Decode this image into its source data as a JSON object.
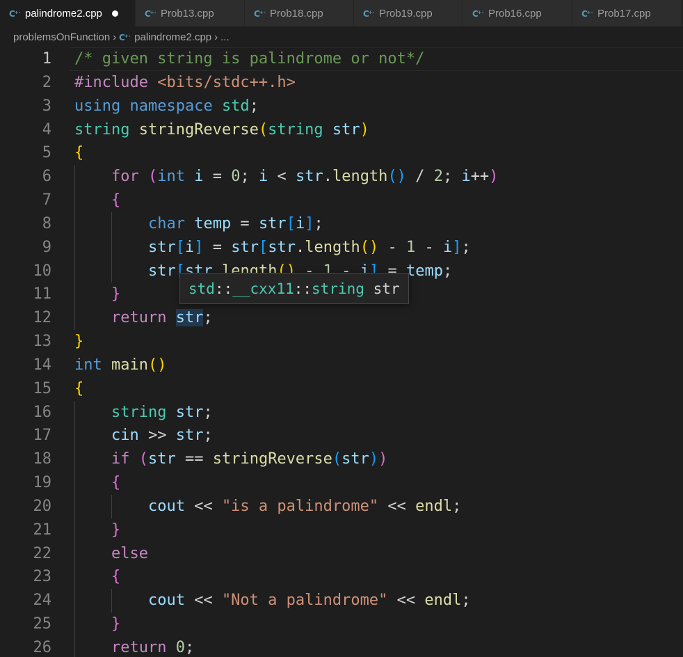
{
  "tabs": [
    {
      "label": "palindrome2.cpp",
      "active": true,
      "dirty": true
    },
    {
      "label": "Prob13.cpp",
      "active": false
    },
    {
      "label": "Prob18.cpp",
      "active": false
    },
    {
      "label": "Prob19.cpp",
      "active": false
    },
    {
      "label": "Prob16.cpp",
      "active": false
    },
    {
      "label": "Prob17.cpp",
      "active": false
    }
  ],
  "breadcrumb": {
    "folder": "problemsOnFunction",
    "file": "palindrome2.cpp",
    "more": "..."
  },
  "hover": {
    "parts": [
      "std",
      "::",
      "__cxx11",
      "::",
      "string",
      " ",
      "str"
    ]
  },
  "colors": {
    "comment": "#6a9955",
    "keyword": "#569cd6",
    "control": "#c586c0",
    "type": "#4ec9b0",
    "function": "#dcdcaa",
    "variable": "#9cdcfe",
    "number": "#b5cea8",
    "string": "#ce9178",
    "bracket1": "#ffd700",
    "bracket2": "#da70d6",
    "bracket3": "#179fff",
    "cpp_icon": "#519aba"
  },
  "editor": {
    "current_line": 1,
    "lines": [
      {
        "n": "1",
        "indent": 0,
        "tokens": [
          [
            "/* given string is palindrome or not*/",
            "comment"
          ]
        ]
      },
      {
        "n": "2",
        "indent": 0,
        "tokens": [
          [
            "#include ",
            "pre"
          ],
          [
            "<bits/stdc++.h>",
            "inc"
          ]
        ]
      },
      {
        "n": "3",
        "indent": 0,
        "tokens": [
          [
            "using ",
            "kw"
          ],
          [
            "namespace ",
            "kw"
          ],
          [
            "std",
            "type"
          ],
          [
            ";",
            "op"
          ]
        ]
      },
      {
        "n": "4",
        "indent": 0,
        "tokens": [
          [
            "string ",
            "type"
          ],
          [
            "stringReverse",
            "fn"
          ],
          [
            "(",
            "b1"
          ],
          [
            "string ",
            "type"
          ],
          [
            "str",
            "var"
          ],
          [
            ")",
            "b1"
          ]
        ]
      },
      {
        "n": "5",
        "indent": 0,
        "tokens": [
          [
            "{",
            "b1"
          ]
        ]
      },
      {
        "n": "6",
        "indent": 1,
        "tokens": [
          [
            "    ",
            "op"
          ],
          [
            "for ",
            "ctrl"
          ],
          [
            "(",
            "b2"
          ],
          [
            "int ",
            "kw"
          ],
          [
            "i",
            "var"
          ],
          [
            " = ",
            "op"
          ],
          [
            "0",
            "num"
          ],
          [
            "; ",
            "op"
          ],
          [
            "i",
            "var"
          ],
          [
            " < ",
            "op"
          ],
          [
            "str",
            "var"
          ],
          [
            ".",
            "op"
          ],
          [
            "length",
            "fn"
          ],
          [
            "()",
            "b3"
          ],
          [
            " / ",
            "op"
          ],
          [
            "2",
            "num"
          ],
          [
            "; ",
            "op"
          ],
          [
            "i",
            "var"
          ],
          [
            "++",
            "op"
          ],
          [
            ")",
            "b2"
          ]
        ]
      },
      {
        "n": "7",
        "indent": 1,
        "tokens": [
          [
            "    ",
            "op"
          ],
          [
            "{",
            "b2"
          ]
        ]
      },
      {
        "n": "8",
        "indent": 2,
        "tokens": [
          [
            "        ",
            "op"
          ],
          [
            "char ",
            "kw"
          ],
          [
            "temp",
            "var"
          ],
          [
            " = ",
            "op"
          ],
          [
            "str",
            "var"
          ],
          [
            "[",
            "b3"
          ],
          [
            "i",
            "var"
          ],
          [
            "]",
            "b3"
          ],
          [
            ";",
            "op"
          ]
        ]
      },
      {
        "n": "9",
        "indent": 2,
        "tokens": [
          [
            "        ",
            "op"
          ],
          [
            "str",
            "var"
          ],
          [
            "[",
            "b3"
          ],
          [
            "i",
            "var"
          ],
          [
            "]",
            "b3"
          ],
          [
            " = ",
            "op"
          ],
          [
            "str",
            "var"
          ],
          [
            "[",
            "b3"
          ],
          [
            "str",
            "var"
          ],
          [
            ".",
            "op"
          ],
          [
            "length",
            "fn"
          ],
          [
            "()",
            "b1"
          ],
          [
            " - ",
            "op"
          ],
          [
            "1",
            "num"
          ],
          [
            " - ",
            "op"
          ],
          [
            "i",
            "var"
          ],
          [
            "]",
            "b3"
          ],
          [
            ";",
            "op"
          ]
        ]
      },
      {
        "n": "10",
        "indent": 2,
        "tokens": [
          [
            "        ",
            "op"
          ],
          [
            "str",
            "var"
          ],
          [
            "[",
            "b3"
          ],
          [
            "str",
            "var"
          ],
          [
            ".",
            "op"
          ],
          [
            "length",
            "fn"
          ],
          [
            "()",
            "b1"
          ],
          [
            " - ",
            "op"
          ],
          [
            "1",
            "num"
          ],
          [
            " - ",
            "op"
          ],
          [
            "i",
            "var"
          ],
          [
            "]",
            "b3"
          ],
          [
            " = ",
            "op"
          ],
          [
            "temp",
            "var"
          ],
          [
            ";",
            "op"
          ]
        ]
      },
      {
        "n": "11",
        "indent": 1,
        "tokens": [
          [
            "    ",
            "op"
          ],
          [
            "}",
            "b2"
          ]
        ]
      },
      {
        "n": "12",
        "indent": 1,
        "tokens": [
          [
            "    ",
            "op"
          ],
          [
            "return ",
            "ctrl"
          ],
          [
            "str",
            "var hl"
          ],
          [
            ";",
            "op"
          ]
        ]
      },
      {
        "n": "13",
        "indent": 0,
        "tokens": [
          [
            "}",
            "b1"
          ]
        ]
      },
      {
        "n": "14",
        "indent": 0,
        "tokens": [
          [
            "int ",
            "kw"
          ],
          [
            "main",
            "fn"
          ],
          [
            "()",
            "b1"
          ]
        ]
      },
      {
        "n": "15",
        "indent": 0,
        "tokens": [
          [
            "{",
            "b1"
          ]
        ]
      },
      {
        "n": "16",
        "indent": 1,
        "tokens": [
          [
            "    ",
            "op"
          ],
          [
            "string ",
            "type"
          ],
          [
            "str",
            "var"
          ],
          [
            ";",
            "op"
          ]
        ]
      },
      {
        "n": "17",
        "indent": 1,
        "tokens": [
          [
            "    ",
            "op"
          ],
          [
            "cin",
            "var"
          ],
          [
            " >> ",
            "op"
          ],
          [
            "str",
            "var"
          ],
          [
            ";",
            "op"
          ]
        ]
      },
      {
        "n": "18",
        "indent": 1,
        "tokens": [
          [
            "    ",
            "op"
          ],
          [
            "if ",
            "ctrl"
          ],
          [
            "(",
            "b2"
          ],
          [
            "str",
            "var"
          ],
          [
            " == ",
            "op"
          ],
          [
            "stringReverse",
            "fn"
          ],
          [
            "(",
            "b3"
          ],
          [
            "str",
            "var"
          ],
          [
            ")",
            "b3"
          ],
          [
            ")",
            "b2"
          ]
        ]
      },
      {
        "n": "19",
        "indent": 1,
        "tokens": [
          [
            "    ",
            "op"
          ],
          [
            "{",
            "b2"
          ]
        ]
      },
      {
        "n": "20",
        "indent": 2,
        "tokens": [
          [
            "        ",
            "op"
          ],
          [
            "cout",
            "var"
          ],
          [
            " << ",
            "op"
          ],
          [
            "\"is a palindrome\"",
            "str"
          ],
          [
            " << ",
            "op"
          ],
          [
            "endl",
            "fn"
          ],
          [
            ";",
            "op"
          ]
        ]
      },
      {
        "n": "21",
        "indent": 1,
        "tokens": [
          [
            "    ",
            "op"
          ],
          [
            "}",
            "b2"
          ]
        ]
      },
      {
        "n": "22",
        "indent": 1,
        "tokens": [
          [
            "    ",
            "op"
          ],
          [
            "else",
            "ctrl"
          ]
        ]
      },
      {
        "n": "23",
        "indent": 1,
        "tokens": [
          [
            "    ",
            "op"
          ],
          [
            "{",
            "b2"
          ]
        ]
      },
      {
        "n": "24",
        "indent": 2,
        "tokens": [
          [
            "        ",
            "op"
          ],
          [
            "cout",
            "var"
          ],
          [
            " << ",
            "op"
          ],
          [
            "\"Not a palindrome\"",
            "str"
          ],
          [
            " << ",
            "op"
          ],
          [
            "endl",
            "fn"
          ],
          [
            ";",
            "op"
          ]
        ]
      },
      {
        "n": "25",
        "indent": 1,
        "tokens": [
          [
            "    ",
            "op"
          ],
          [
            "}",
            "b2"
          ]
        ]
      },
      {
        "n": "26",
        "indent": 1,
        "tokens": [
          [
            "    ",
            "op"
          ],
          [
            "return ",
            "ctrl"
          ],
          [
            "0",
            "num"
          ],
          [
            ";",
            "op"
          ]
        ]
      }
    ]
  }
}
